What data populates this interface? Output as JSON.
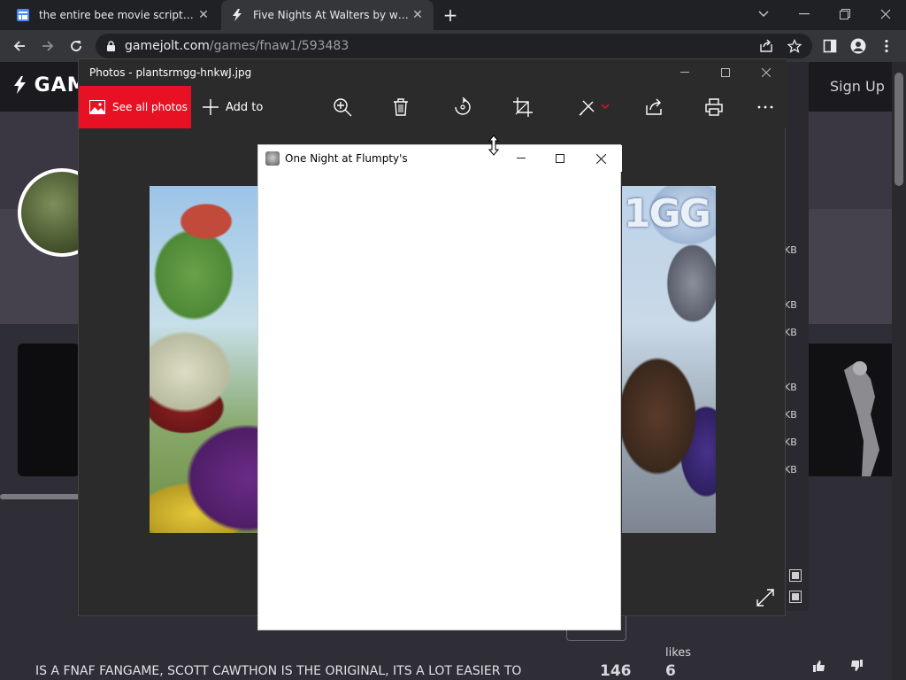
{
  "browser": {
    "tabs": [
      {
        "title": "the entire bee movie script - For",
        "active": false
      },
      {
        "title": "Five Nights At Walters by william",
        "active": true
      }
    ],
    "new_tab_label": "+",
    "url_host": "gamejolt.com",
    "url_path": "/games/fnaw1/593483"
  },
  "page": {
    "logo": "GAM",
    "signup": "Sign Up",
    "kb_labels": [
      "KB",
      "KB",
      "KB",
      "KB",
      "KB",
      "KB",
      "KB"
    ],
    "description": "IS A FNAF FANGAME, SCOTT CAWTHON IS THE ORIGINAL, ITS A LOT EASIER TO",
    "count": "146",
    "likes_label": "likes",
    "likes_count": "6"
  },
  "photos": {
    "title": "Photos - plantsrmgg-hnkwJ.jpg",
    "see_all": "See all photos",
    "add_to": "Add to",
    "image_logo_text": "1GG"
  },
  "flumpty": {
    "title": "One Night at Flumpty's"
  },
  "colors": {
    "accent_red": "#e81123",
    "chrome_dark": "#202124",
    "chrome_toolbar": "#35363a"
  }
}
